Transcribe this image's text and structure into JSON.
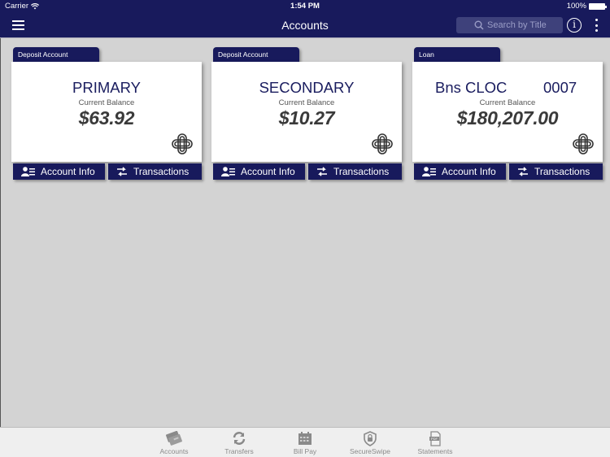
{
  "status_bar": {
    "carrier": "Carrier",
    "time": "1:54 PM",
    "battery": "100%"
  },
  "nav": {
    "title": "Accounts",
    "search_placeholder": "Search by Title",
    "info_label": "i"
  },
  "accounts": [
    {
      "type": "Deposit Account",
      "name": "PRIMARY",
      "number": "",
      "balance_label": "Current Balance",
      "balance": "$63.92",
      "info_label": "Account Info",
      "transactions_label": "Transactions"
    },
    {
      "type": "Deposit Account",
      "name": "SECONDARY",
      "number": "",
      "balance_label": "Current Balance",
      "balance": "$10.27",
      "info_label": "Account Info",
      "transactions_label": "Transactions"
    },
    {
      "type": "Loan",
      "name": "Bns CLOC",
      "number": "0007",
      "balance_label": "Current Balance",
      "balance": "$180,207.00",
      "info_label": "Account Info",
      "transactions_label": "Transactions"
    }
  ],
  "tabbar": {
    "items": [
      {
        "label": "Accounts",
        "icon": "cards-icon"
      },
      {
        "label": "Transfers",
        "icon": "refresh-arrows-icon"
      },
      {
        "label": "Bill Pay",
        "icon": "calendar-icon"
      },
      {
        "label": "SecureSwipe",
        "icon": "shield-lock-icon"
      },
      {
        "label": "Statements",
        "icon": "pdf-document-icon"
      }
    ]
  },
  "colors": {
    "brand_navy": "#181a5c",
    "background": "#d3d3d3",
    "balance_text": "#3a3a3a"
  }
}
